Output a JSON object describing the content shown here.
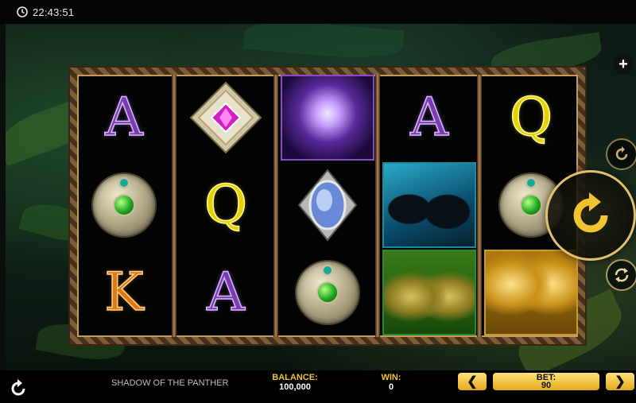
{
  "status": {
    "time": "22:43:51"
  },
  "reels": [
    [
      "A",
      "gem-diamond",
      "K"
    ],
    [
      "diamond-pink",
      "Q",
      "A"
    ],
    [
      "leopard-purple",
      "moonstone",
      "gem-diamond"
    ],
    [
      "A",
      "panthers-black",
      "leopards-green"
    ],
    [
      "Q",
      "gem-diamond",
      "gold-statues"
    ]
  ],
  "controls": {
    "plus_label": "+",
    "prev_bet": "❮",
    "next_bet": "❯"
  },
  "footer": {
    "game_title": "SHADOW OF THE PANTHER",
    "balance_label": "BALANCE:",
    "balance_value": "100,000",
    "win_label": "WIN:",
    "win_value": "0",
    "bet_label": "BET:",
    "bet_value": "90"
  }
}
